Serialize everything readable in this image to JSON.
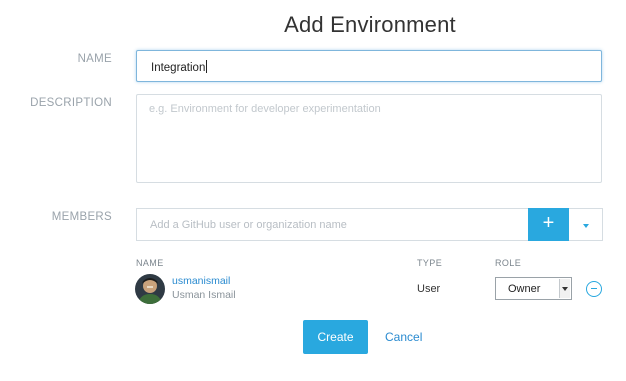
{
  "form": {
    "title": "Add Environment",
    "name_label": "NAME",
    "name_value": "Integration",
    "description_label": "DESCRIPTION",
    "description_placeholder": "e.g. Environment for developer experimentation",
    "members_label": "MEMBERS",
    "member_search_placeholder": "Add a GitHub user or organization name",
    "add_button_icon": "plus-icon",
    "dropdown_icon": "caret-down-icon"
  },
  "members_table": {
    "columns": [
      "NAME",
      "TYPE",
      "ROLE"
    ],
    "rows": [
      {
        "avatar_icon": "user-avatar",
        "login": "usmanismail",
        "full_name": "Usman Ismail",
        "type": "User",
        "role": "Owner",
        "remove_icon": "minus-circle-icon"
      }
    ]
  },
  "actions": {
    "create_label": "Create",
    "cancel_label": "Cancel"
  },
  "colors": {
    "accent": "#29a8df",
    "link": "#2a8bd0",
    "label": "#9aa3ab"
  }
}
